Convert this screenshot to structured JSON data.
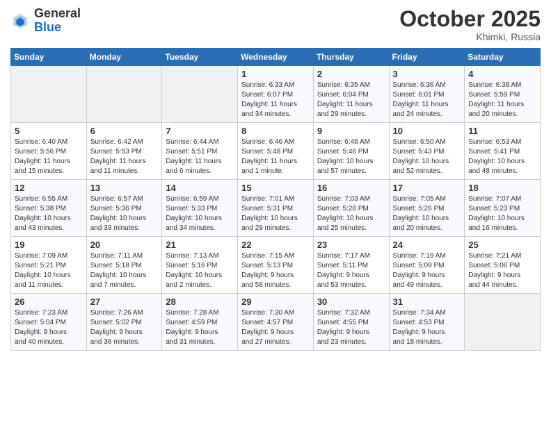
{
  "header": {
    "logo_general": "General",
    "logo_blue": "Blue",
    "month_title": "October 2025",
    "location": "Khimki, Russia"
  },
  "columns": [
    "Sunday",
    "Monday",
    "Tuesday",
    "Wednesday",
    "Thursday",
    "Friday",
    "Saturday"
  ],
  "weeks": [
    [
      {
        "num": "",
        "info": ""
      },
      {
        "num": "",
        "info": ""
      },
      {
        "num": "",
        "info": ""
      },
      {
        "num": "1",
        "info": "Sunrise: 6:33 AM\nSunset: 6:07 PM\nDaylight: 11 hours\nand 34 minutes."
      },
      {
        "num": "2",
        "info": "Sunrise: 6:35 AM\nSunset: 6:04 PM\nDaylight: 11 hours\nand 29 minutes."
      },
      {
        "num": "3",
        "info": "Sunrise: 6:36 AM\nSunset: 6:01 PM\nDaylight: 11 hours\nand 24 minutes."
      },
      {
        "num": "4",
        "info": "Sunrise: 6:38 AM\nSunset: 5:59 PM\nDaylight: 11 hours\nand 20 minutes."
      }
    ],
    [
      {
        "num": "5",
        "info": "Sunrise: 6:40 AM\nSunset: 5:56 PM\nDaylight: 11 hours\nand 15 minutes."
      },
      {
        "num": "6",
        "info": "Sunrise: 6:42 AM\nSunset: 5:53 PM\nDaylight: 11 hours\nand 11 minutes."
      },
      {
        "num": "7",
        "info": "Sunrise: 6:44 AM\nSunset: 5:51 PM\nDaylight: 11 hours\nand 6 minutes."
      },
      {
        "num": "8",
        "info": "Sunrise: 6:46 AM\nSunset: 5:48 PM\nDaylight: 11 hours\nand 1 minute."
      },
      {
        "num": "9",
        "info": "Sunrise: 6:48 AM\nSunset: 5:46 PM\nDaylight: 10 hours\nand 57 minutes."
      },
      {
        "num": "10",
        "info": "Sunrise: 6:50 AM\nSunset: 5:43 PM\nDaylight: 10 hours\nand 52 minutes."
      },
      {
        "num": "11",
        "info": "Sunrise: 6:53 AM\nSunset: 5:41 PM\nDaylight: 10 hours\nand 48 minutes."
      }
    ],
    [
      {
        "num": "12",
        "info": "Sunrise: 6:55 AM\nSunset: 5:38 PM\nDaylight: 10 hours\nand 43 minutes."
      },
      {
        "num": "13",
        "info": "Sunrise: 6:57 AM\nSunset: 5:36 PM\nDaylight: 10 hours\nand 39 minutes."
      },
      {
        "num": "14",
        "info": "Sunrise: 6:59 AM\nSunset: 5:33 PM\nDaylight: 10 hours\nand 34 minutes."
      },
      {
        "num": "15",
        "info": "Sunrise: 7:01 AM\nSunset: 5:31 PM\nDaylight: 10 hours\nand 29 minutes."
      },
      {
        "num": "16",
        "info": "Sunrise: 7:03 AM\nSunset: 5:28 PM\nDaylight: 10 hours\nand 25 minutes."
      },
      {
        "num": "17",
        "info": "Sunrise: 7:05 AM\nSunset: 5:26 PM\nDaylight: 10 hours\nand 20 minutes."
      },
      {
        "num": "18",
        "info": "Sunrise: 7:07 AM\nSunset: 5:23 PM\nDaylight: 10 hours\nand 16 minutes."
      }
    ],
    [
      {
        "num": "19",
        "info": "Sunrise: 7:09 AM\nSunset: 5:21 PM\nDaylight: 10 hours\nand 11 minutes."
      },
      {
        "num": "20",
        "info": "Sunrise: 7:11 AM\nSunset: 5:18 PM\nDaylight: 10 hours\nand 7 minutes."
      },
      {
        "num": "21",
        "info": "Sunrise: 7:13 AM\nSunset: 5:16 PM\nDaylight: 10 hours\nand 2 minutes."
      },
      {
        "num": "22",
        "info": "Sunrise: 7:15 AM\nSunset: 5:13 PM\nDaylight: 9 hours\nand 58 minutes."
      },
      {
        "num": "23",
        "info": "Sunrise: 7:17 AM\nSunset: 5:11 PM\nDaylight: 9 hours\nand 53 minutes."
      },
      {
        "num": "24",
        "info": "Sunrise: 7:19 AM\nSunset: 5:09 PM\nDaylight: 9 hours\nand 49 minutes."
      },
      {
        "num": "25",
        "info": "Sunrise: 7:21 AM\nSunset: 5:06 PM\nDaylight: 9 hours\nand 44 minutes."
      }
    ],
    [
      {
        "num": "26",
        "info": "Sunrise: 7:23 AM\nSunset: 5:04 PM\nDaylight: 9 hours\nand 40 minutes."
      },
      {
        "num": "27",
        "info": "Sunrise: 7:26 AM\nSunset: 5:02 PM\nDaylight: 9 hours\nand 36 minutes."
      },
      {
        "num": "28",
        "info": "Sunrise: 7:28 AM\nSunset: 4:59 PM\nDaylight: 9 hours\nand 31 minutes."
      },
      {
        "num": "29",
        "info": "Sunrise: 7:30 AM\nSunset: 4:57 PM\nDaylight: 9 hours\nand 27 minutes."
      },
      {
        "num": "30",
        "info": "Sunrise: 7:32 AM\nSunset: 4:55 PM\nDaylight: 9 hours\nand 23 minutes."
      },
      {
        "num": "31",
        "info": "Sunrise: 7:34 AM\nSunset: 4:53 PM\nDaylight: 9 hours\nand 18 minutes."
      },
      {
        "num": "",
        "info": ""
      }
    ]
  ]
}
